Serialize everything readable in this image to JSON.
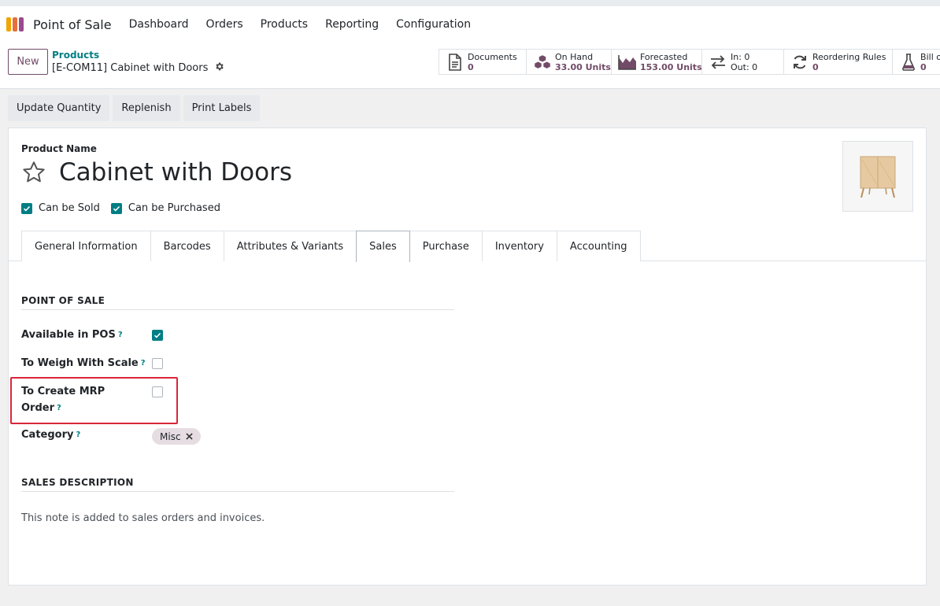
{
  "app": {
    "name": "Point of Sale"
  },
  "colors": {
    "brand": "#714b67",
    "accent": "#017e84",
    "highlight": "#d9263a"
  },
  "nav": {
    "items": [
      "Dashboard",
      "Orders",
      "Products",
      "Reporting",
      "Configuration"
    ]
  },
  "control": {
    "new_label": "New",
    "breadcrumb": "Products",
    "record_title": "[E-COM11] Cabinet with Doors"
  },
  "stats": [
    {
      "icon": "document-icon",
      "label": "Documents",
      "value": "0"
    },
    {
      "icon": "cubes-icon",
      "label": "On Hand",
      "value": "33.00 Units"
    },
    {
      "icon": "area-chart-icon",
      "label": "Forecasted",
      "value": "153.00 Units"
    },
    {
      "icon": "exchange-icon",
      "label": "In: 0",
      "value": "Out: 0"
    },
    {
      "icon": "refresh-icon",
      "label": "Reordering Rules",
      "value": "0"
    },
    {
      "icon": "flask-icon",
      "label": "Bill o",
      "value": "0"
    }
  ],
  "actions": [
    "Update Quantity",
    "Replenish",
    "Print Labels"
  ],
  "form": {
    "product_name_label": "Product Name",
    "title": "Cabinet with Doors",
    "can_be_sold": "Can be Sold",
    "can_be_purchased": "Can be Purchased"
  },
  "tabs": [
    "General Information",
    "Barcodes",
    "Attributes & Variants",
    "Sales",
    "Purchase",
    "Inventory",
    "Accounting"
  ],
  "active_tab": "Sales",
  "sales": {
    "pos_section": "POINT OF SALE",
    "available_in_pos": "Available in POS",
    "to_weigh": "To Weigh With Scale",
    "to_create_mrp_line1": "To Create MRP",
    "to_create_mrp_line2": "Order",
    "help_mark": "?",
    "category_label": "Category",
    "category_value": "Misc",
    "sales_desc_section": "SALES DESCRIPTION",
    "sales_desc_placeholder": "This note is added to sales orders and invoices."
  }
}
